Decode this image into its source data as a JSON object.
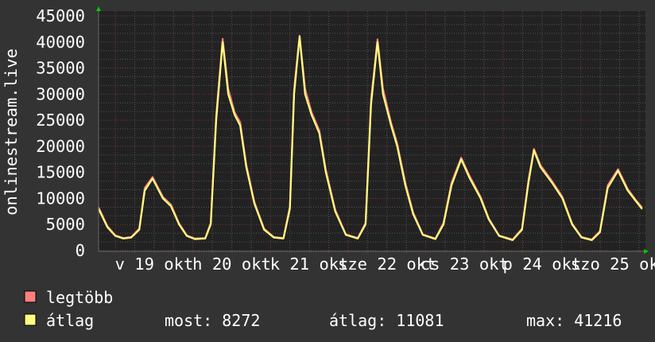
{
  "chart_data": {
    "type": "line",
    "ylabel": "onlinestream.live",
    "ylim": [
      0,
      45000
    ],
    "yticks": [
      "0",
      "5000",
      "10000",
      "15000",
      "20000",
      "25000",
      "30000",
      "35000",
      "40000",
      "45000"
    ],
    "xlim_hours": [
      -5.2,
      163.5
    ],
    "x_unit": "hours since 19 okt 00:00",
    "xticks": [
      "v 19 okt",
      "h 20 okt",
      "k 21 okt",
      "sze 22 okt",
      "cs 23 okt",
      "p 24 okt",
      "szo 25 okt"
    ],
    "grid": true,
    "x": [
      -5.2,
      -2.5,
      0,
      2.5,
      4.9,
      7.4,
      9.1,
      11.5,
      14.7,
      17.2,
      19.7,
      22.1,
      24.6,
      27.8,
      29.5,
      31.2,
      33.2,
      34.9,
      36.9,
      38.6,
      40.5,
      43,
      46,
      49,
      52,
      54,
      55.3,
      57,
      58.7,
      60.7,
      63.1,
      65.1,
      68,
      71.3,
      75,
      77.4,
      79.1,
      81.1,
      82.8,
      85.3,
      87.2,
      89.7,
      92.1,
      95.1,
      99,
      101.5,
      104,
      107,
      109.5,
      113,
      115.5,
      118.7,
      122.9,
      125.8,
      127.8,
      129.5,
      131.5,
      135.1,
      138.3,
      141.3,
      144.2,
      147.4,
      149.9,
      152.3,
      155.5,
      158.5,
      161,
      162.9
    ],
    "series": [
      {
        "name": "legtöbb",
        "color": "#ff7f7f",
        "values": [
          8300,
          4700,
          2900,
          2400,
          2600,
          4200,
          12000,
          14100,
          10300,
          8800,
          5200,
          2900,
          2300,
          2400,
          5300,
          26000,
          40600,
          31000,
          26500,
          24600,
          16500,
          9300,
          4200,
          2600,
          2400,
          8500,
          31000,
          41216,
          31000,
          26500,
          23000,
          15500,
          7800,
          3100,
          2400,
          5300,
          29000,
          40500,
          31000,
          24500,
          20500,
          13000,
          7300,
          3100,
          2300,
          5300,
          13000,
          17800,
          14400,
          10300,
          6200,
          2900,
          2100,
          4200,
          13500,
          19500,
          16400,
          13300,
          10300,
          5200,
          2600,
          2100,
          3700,
          12500,
          15600,
          11800,
          9700,
          8300
        ]
      },
      {
        "name": "átlag",
        "color": "#ffff7f",
        "values": [
          8000,
          4500,
          2800,
          2300,
          2500,
          4000,
          11500,
          13800,
          10000,
          8500,
          5000,
          2800,
          2200,
          2300,
          5000,
          25000,
          40000,
          30000,
          26000,
          24000,
          16000,
          9000,
          4000,
          2500,
          2300,
          8000,
          30000,
          41000,
          30000,
          26000,
          22500,
          15000,
          7500,
          3000,
          2300,
          5000,
          28000,
          40000,
          30000,
          24000,
          20000,
          12500,
          7000,
          3000,
          2200,
          5000,
          12500,
          17500,
          14000,
          10000,
          6000,
          2800,
          2000,
          4000,
          13000,
          19200,
          16000,
          13000,
          10000,
          5000,
          2500,
          2000,
          3500,
          12000,
          15300,
          11500,
          9500,
          8000
        ]
      }
    ],
    "legend": {
      "items": [
        {
          "label": "legtöbb",
          "color": "#ff7f7f"
        },
        {
          "label": "átlag",
          "color": "#ffff7f"
        }
      ],
      "stats": {
        "current": "most: 8272",
        "average": "átlag: 11081",
        "maximum": "max: 41216"
      },
      "placement": "bottom-left"
    }
  }
}
